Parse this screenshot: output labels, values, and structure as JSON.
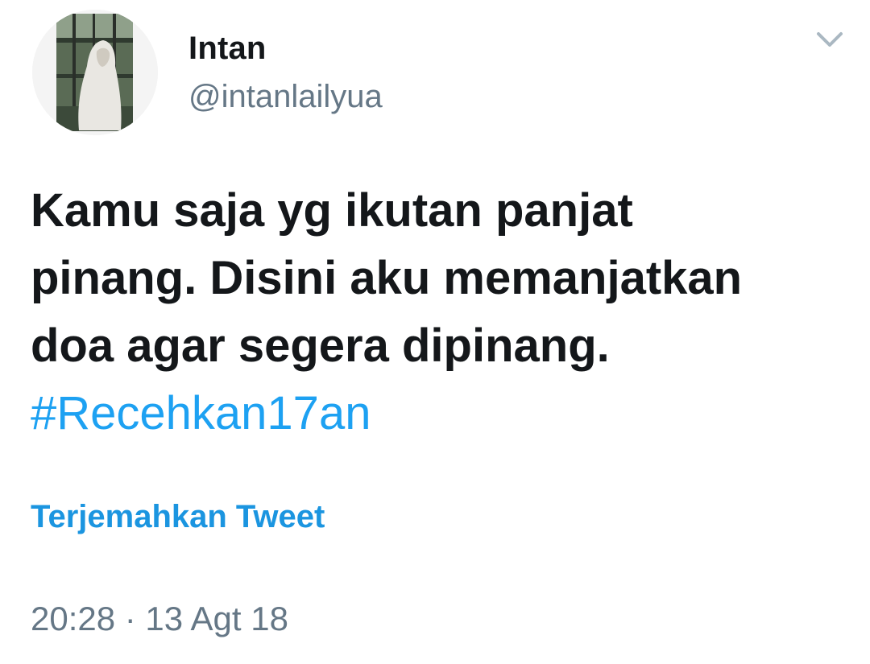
{
  "user": {
    "display_name": "Intan",
    "handle": "@intanlailyua",
    "avatar_icon": "profile-photo-hooded-figure"
  },
  "menu": {
    "icon": "chevron-down-icon"
  },
  "tweet": {
    "lines": [
      "Kamu saja yg ikutan panjat",
      "pinang. Disini aku memanjatkan",
      "doa agar segera dipinang."
    ],
    "hashtag": "#Recehkan17an",
    "hashtag_color": "#1da1f2"
  },
  "translate_label": "Terjemahkan Tweet",
  "timestamp": "20:28 · 13 Agt 18"
}
